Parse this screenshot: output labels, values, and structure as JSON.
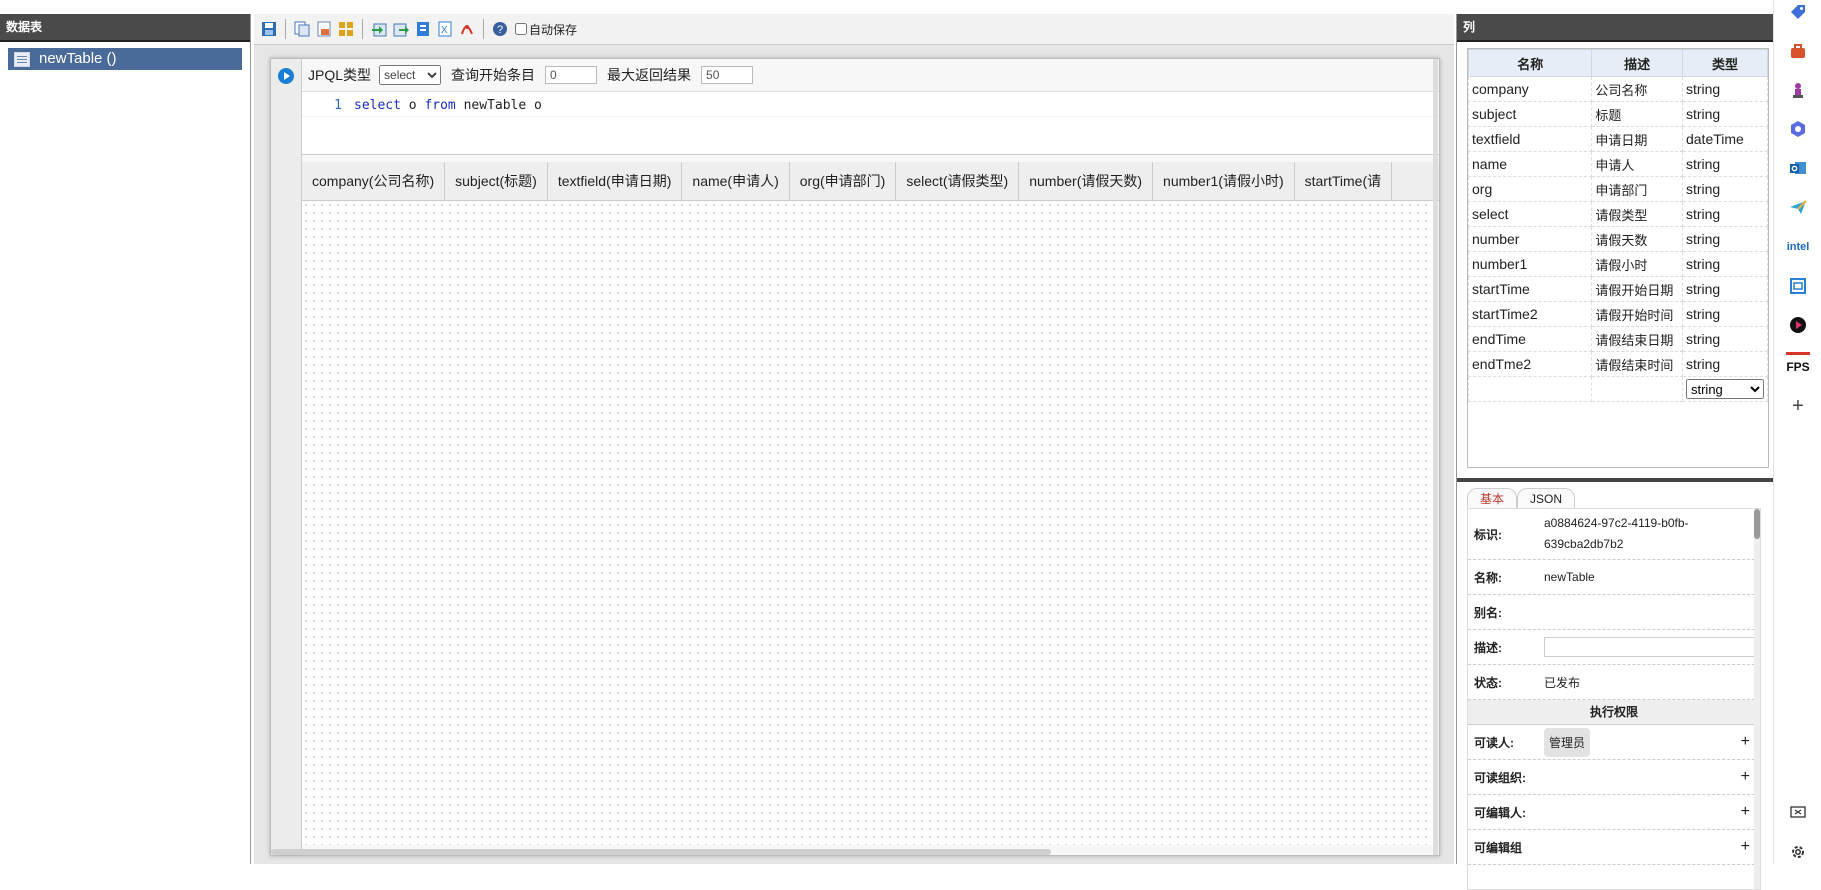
{
  "left_panel": {
    "title": "数据表",
    "tree_items": [
      {
        "label": "newTable ()"
      }
    ]
  },
  "toolbar": {
    "icons": [
      "save-icon",
      "copy-icon",
      "paste-icon",
      "grid-icon",
      "import-icon",
      "export-icon",
      "doc-icon",
      "excel-icon",
      "pdf-icon",
      "help-icon"
    ],
    "autosave_label": "自动保存",
    "autosave_checked": false
  },
  "query": {
    "type_label": "JPQL类型",
    "type_value": "select",
    "type_options": [
      "select"
    ],
    "start_label": "查询开始条目",
    "start_value": "0",
    "max_label": "最大返回结果",
    "max_value": "50",
    "code_line_number": "1",
    "code": {
      "kw1": "select",
      "t1": " o ",
      "kw2": "from",
      "t2": " newTable o"
    }
  },
  "results": {
    "columns": [
      "company(公司名称)",
      "subject(标题)",
      "textfield(申请日期)",
      "name(申请人)",
      "org(申请部门)",
      "select(请假类型)",
      "number(请假天数)",
      "number1(请假小时)",
      "startTime(请"
    ]
  },
  "right_panel": {
    "title": "列",
    "headers": {
      "name": "名称",
      "desc": "描述",
      "type": "类型"
    },
    "rows": [
      {
        "name": "company",
        "desc": "公司名称",
        "type": "string"
      },
      {
        "name": "subject",
        "desc": "标题",
        "type": "string"
      },
      {
        "name": "textfield",
        "desc": "申请日期",
        "type": "dateTime"
      },
      {
        "name": "name",
        "desc": "申请人",
        "type": "string"
      },
      {
        "name": "org",
        "desc": "申请部门",
        "type": "string"
      },
      {
        "name": "select",
        "desc": "请假类型",
        "type": "string"
      },
      {
        "name": "number",
        "desc": "请假天数",
        "type": "string"
      },
      {
        "name": "number1",
        "desc": "请假小时",
        "type": "string"
      },
      {
        "name": "startTime",
        "desc": "请假开始日期",
        "type": "string"
      },
      {
        "name": "startTime2",
        "desc": "请假开始时间",
        "type": "string"
      },
      {
        "name": "endTime",
        "desc": "请假结束日期",
        "type": "string"
      },
      {
        "name": "endTme2",
        "desc": "请假结束时间",
        "type": "string"
      }
    ],
    "new_row_type": "string",
    "tabs": {
      "basic": "基本",
      "json": "JSON"
    },
    "props": {
      "id_label": "标识:",
      "id_value_1": "a0884624-97c2-4119-b0fb-",
      "id_value_2": "639cba2db7b2",
      "name_label": "名称:",
      "name_value": "newTable",
      "alias_label": "别名:",
      "desc_label": "描述:",
      "status_label": "状态:",
      "status_value": "已发布",
      "perm_title": "执行权限",
      "readers_label": "可读人:",
      "readers_value": "管理员",
      "read_orgs_label": "可读组织:",
      "editors_label": "可编辑人:",
      "edit_orgs_label": "可编辑组"
    }
  },
  "dock": {
    "icons": [
      "tag-icon",
      "toolbox-icon",
      "chess-icon",
      "copilot-icon",
      "outlook-icon",
      "paper-plane-icon",
      "intel-icon",
      "window-icon",
      "play-icon",
      "fps-icon",
      "add-icon",
      "screen-cast-icon",
      "settings-icon"
    ],
    "intel_text": "intel",
    "fps_text": "FPS",
    "add_text": "+"
  }
}
